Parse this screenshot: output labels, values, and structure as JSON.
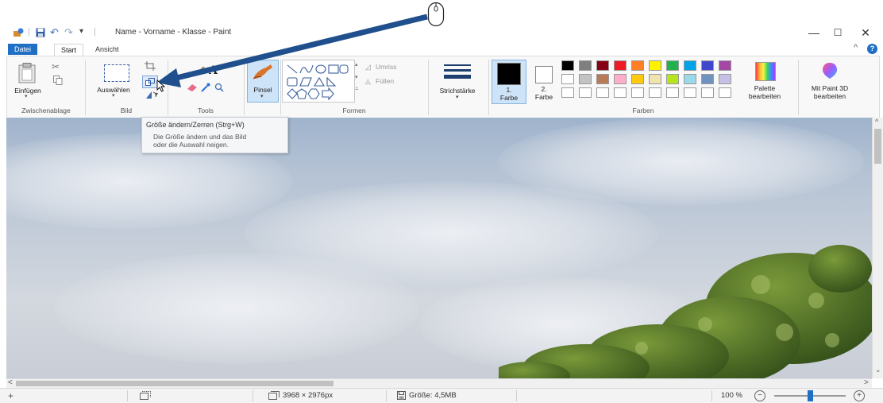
{
  "titlebar": {
    "quick_access_separator": "|",
    "dropdown_glyph": "▾",
    "title": "Name - Vorname  - Klasse - Paint",
    "minimize": "—",
    "maximize": "☐",
    "close": "✕"
  },
  "tabs": {
    "file": "Datei",
    "start": "Start",
    "view": "Ansicht",
    "collapse": "^",
    "help": "?"
  },
  "ribbon": {
    "clipboard": {
      "paste": "Einfügen",
      "group": "Zwischenablage"
    },
    "image": {
      "select": "Auswählen",
      "group": "Bild"
    },
    "tools": {
      "text_icon": "A",
      "group": "Tools"
    },
    "brushes": {
      "label": "Pinsel"
    },
    "shapes": {
      "outline": "Umriss",
      "fill": "Füllen",
      "group": "Formen"
    },
    "stroke": {
      "label": "Strichstärke"
    },
    "colors": {
      "color1_num": "1.",
      "color1_label": "Farbe",
      "color2_num": "2.",
      "color2_label": "Farbe",
      "group": "Farben",
      "palette_line1": "Palette",
      "palette_line2": "bearbeiten",
      "paint3d_line1": "Mit Paint 3D",
      "paint3d_line2": "bearbeiten",
      "color1_value": "#000000",
      "color2_value": "#ffffff",
      "palette_row1": [
        "#000000",
        "#7f7f7f",
        "#880015",
        "#ed1c24",
        "#ff7f27",
        "#fff200",
        "#22b14c",
        "#00a2e8",
        "#3f48cc",
        "#a349a4"
      ],
      "palette_row2": [
        "#ffffff",
        "#c3c3c3",
        "#b97a57",
        "#ffaec9",
        "#ffc90e",
        "#efe4b0",
        "#b5e61d",
        "#99d9ea",
        "#7092be",
        "#c8bfe7"
      ],
      "palette_row3": [
        "#ffffff",
        "#ffffff",
        "#ffffff",
        "#ffffff",
        "#ffffff",
        "#ffffff",
        "#ffffff",
        "#ffffff",
        "#ffffff",
        "#ffffff"
      ]
    }
  },
  "tooltip": {
    "title": "Größe ändern/Zerren (Strg+W)",
    "line1": "Die Größe ändern und das Bild",
    "line2": "oder die Auswahl neigen."
  },
  "annotation": {
    "icon": "mouse-icon",
    "arrow_color": "#1f4f8c"
  },
  "scroll": {
    "up": "^",
    "down": "⌄",
    "left": "<",
    "right": ">"
  },
  "status": {
    "move_icon": "+",
    "dimensions": "3968 × 2976px",
    "size": "Größe: 4,5MB",
    "zoom": "100 %",
    "zoom_out": "−",
    "zoom_in": "+",
    "zoom_fraction": 0.5
  }
}
